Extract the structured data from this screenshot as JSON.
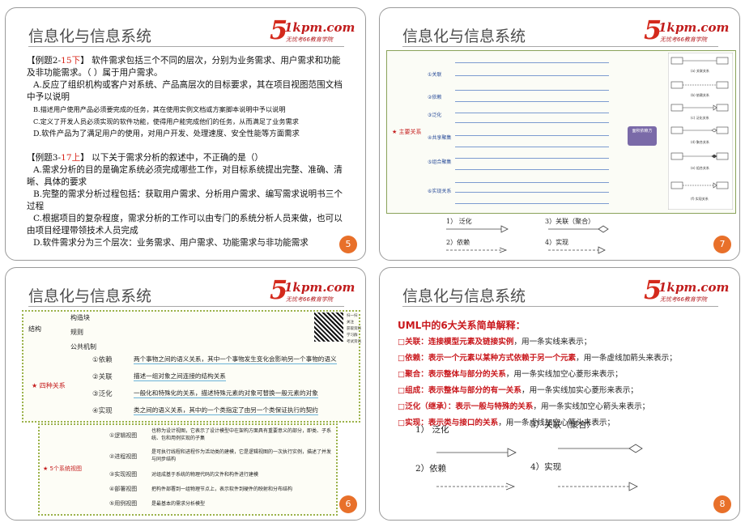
{
  "slide_title": "信息化与信息系统",
  "logo": {
    "five": "5",
    "kpm": "1kpm.com",
    "slogan": "无忧考66教育学院"
  },
  "slide5": {
    "page": "5",
    "q1": {
      "head_pre": "【例题2-",
      "head_red": "15下",
      "head_post": "】 软件需求包括三个不同的层次，分别为业务需求、用户需求和功能及非功能需求。（ ）属于用户需求。",
      "a": "A.反应了组织机构或客户对系统、产品高层次的目标要求，其在项目视图范围文档中予以说明",
      "b": "B.描述用户使用产品必须要完成的任务，其在使用实例文档或方案脚本说明中予以说明",
      "c": "C.定义了开发人员必须实现的软件功能，使得用户能完成他们的任务，从而满足了业务需求",
      "d": "D.软件产品为了满足用户的使用，对用户开发、处理速度、安全性能等方面需求"
    },
    "q2": {
      "head_pre": "【例题3-",
      "head_red": "17上",
      "head_post": "】 以下关于需求分析的叙述中，不正确的是（）",
      "a": "A.需求分析的目的是确定系统必须完成哪些工作，对目标系统提出完整、准确、清晰、具体的要求",
      "b": "B.完整的需求分析过程包括：获取用户需求、分析用户需求、编写需求说明书三个过程",
      "c": "C.根据项目的复杂程度，需求分析的工作可以由专门的系统分析人员来做，也可以由项目经理带领技术人员完成",
      "d": "D.软件需求分为三个层次：业务需求、用户需求、功能需求与非功能需求"
    }
  },
  "slide7": {
    "page": "7",
    "root": "★ 主要关系",
    "branches": [
      "①关联",
      "②依赖",
      "③泛化",
      "④共享聚集",
      "⑤组合聚集",
      "⑥实现关系"
    ],
    "mid_label": "面积依赖方",
    "uml_labels": [
      "(a) 关联关系",
      "(b) 依赖关系",
      "(c) 泛化关系",
      "(d) 聚合关系",
      "(e) 组合关系",
      "(f) 实现关系"
    ],
    "legend": [
      "1） 泛化",
      "3）关联（聚合）",
      "2）依赖",
      "4）实现"
    ]
  },
  "slide6": {
    "page": "6",
    "structure": "结构",
    "structure_items": [
      "构造块",
      "规则",
      "公共机制"
    ],
    "four": "★ 四种关系",
    "relations": [
      {
        "num": "①依赖",
        "desc": "两个事物之间的语义关系，其中一个事物发生变化会影响另一个事物的语义"
      },
      {
        "num": "②关联",
        "desc": "描述一组对象之间连接的结构关系"
      },
      {
        "num": "③泛化",
        "desc": "一般化和特殊化的关系，描述特殊元素的对象可替换一般元素的对象"
      },
      {
        "num": "④实现",
        "desc": "类之间的语义关系，其中的一个类指定了由另一个类保证执行的契约"
      }
    ],
    "views_root": "★ 5个系统视图",
    "views": [
      {
        "num": "①逻辑视图",
        "desc": "也称为设计视图，它表示了设计模型中在架构方面具有重要意义的部分，即类、子系统、包和用例实现的子集"
      },
      {
        "num": "②进程视图",
        "desc": "是可执行线程和进程作为活动类的建模，它是逻辑视图的一次执行实例，描述了并发与同步结构"
      },
      {
        "num": "③实现视图",
        "desc": "对组成基于系统的物理代码的文件和构件进行建模"
      },
      {
        "num": "④部署视图",
        "desc": "把构件部署到一组物理节点上，表示软件到硬件的映射和分布结构"
      },
      {
        "num": "⑤用例视图",
        "desc": "是最基本的需求分析模型"
      }
    ],
    "qr_labels": [
      "扫一扫",
      "关注",
      "获取资料",
      "学习群",
      "考试资讯"
    ]
  },
  "slide8": {
    "page": "8",
    "title": "UML中的6大关系简单解释：",
    "rows": [
      {
        "key": "□关联：",
        "bold": "连接模型元素及链接实例",
        "rest": "，用一条实线来表示；"
      },
      {
        "key": "□依赖：",
        "bold": "表示一个元素以某种方式依赖于另一个元素",
        "rest": "，用一条虚线加箭头来表示；"
      },
      {
        "key": "□聚合：",
        "bold": "表示整体与部分的关系",
        "rest": "，用一条实线加空心菱形来表示；"
      },
      {
        "key": "□组成：",
        "bold": "表示整体与部分的有一关系",
        "rest": "，用一条实线加实心菱形来表示；"
      },
      {
        "key": "□泛化（继承）：",
        "bold": "表示一般与特殊的关系",
        "rest": "，用一条实线加空心箭头来表示；"
      },
      {
        "key": "□实现：",
        "bold": "表示类与接口的关系",
        "rest": "，用一条虚线加空心箭头来表示；"
      }
    ],
    "legend": [
      "1） 泛化",
      "3）关联（聚合）",
      "2）依赖",
      "4）实现"
    ]
  },
  "colors": {
    "accent": "#d8251a",
    "page_badge": "#e8702a",
    "mind_border": "#9bb24a"
  }
}
